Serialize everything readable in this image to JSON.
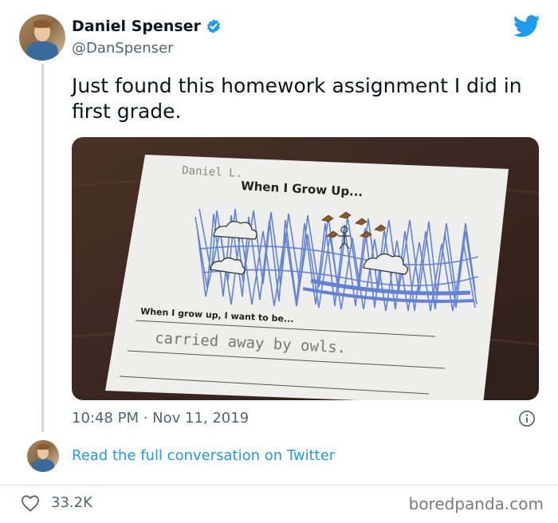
{
  "author": {
    "name": "Daniel Spenser",
    "handle": "@DanSpenser",
    "verified_icon": "verified-badge-icon",
    "colors": {
      "verified": "#1d9bf0",
      "handle": "#536471"
    }
  },
  "tweet": {
    "text": "Just found this homework assignment I did in first grade.",
    "timestamp": "10:48 PM · Nov 11, 2019"
  },
  "photo": {
    "student_name": "Daniel L.",
    "worksheet_title": "When I Grow Up...",
    "prompt": "When I grow up, I want to be...",
    "answer": "carried away by owls."
  },
  "conversation": {
    "link_label": "Read the full conversation on Twitter"
  },
  "footer": {
    "likes": "33.2K",
    "watermark": "boredpanda.com"
  },
  "icons": {
    "brand": "twitter-bird-icon",
    "info": "info-icon",
    "like": "heart-icon"
  },
  "theme": {
    "accent": "#1d9bf0",
    "text": "#0f1419",
    "muted": "#536471",
    "border": "#cfd9de"
  }
}
